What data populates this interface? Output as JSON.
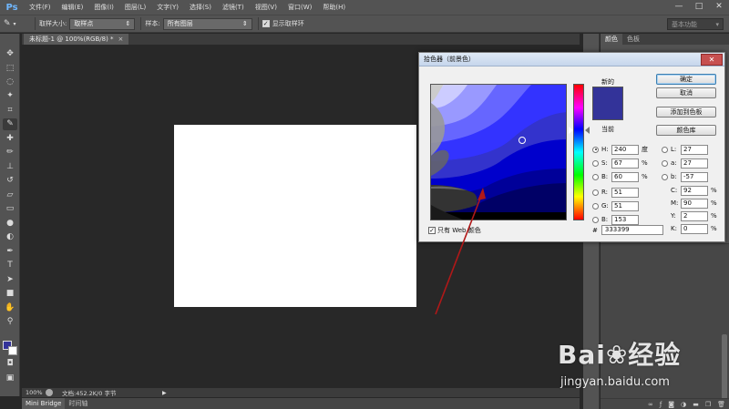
{
  "app": {
    "logo": "Ps",
    "menu": [
      "文件(F)",
      "编辑(E)",
      "图像(I)",
      "图层(L)",
      "文字(Y)",
      "选择(S)",
      "滤镜(T)",
      "视图(V)",
      "窗口(W)",
      "帮助(H)"
    ],
    "window_controls": [
      "—",
      "□",
      "✕"
    ]
  },
  "options_bar": {
    "sample_size_label": "取样大小:",
    "sample_size_value": "取样点",
    "sample_label": "样本:",
    "sample_value": "所有图层",
    "show_ring_label": "显示取样环",
    "show_ring_checked": true,
    "workspace_value": "基本功能"
  },
  "document": {
    "tab_title": "未标题-1 @ 100%(RGB/8) *",
    "tab_close": "×",
    "zoom": "100%",
    "doc_info": "文档:452.2K/0 字节",
    "canvas_color": "#ffffff"
  },
  "bottom_tabs": [
    "Mini Bridge",
    "时间轴"
  ],
  "right_panel": {
    "tabs": [
      "颜色",
      "色板"
    ]
  },
  "color_picker": {
    "title": "拾色器（前景色）",
    "new_label": "新的",
    "current_label": "当前",
    "buttons": {
      "ok": "确定",
      "cancel": "取消",
      "add_to_swatches": "添加到色板",
      "color_libraries": "颜色库"
    },
    "hsb": [
      {
        "label": "H:",
        "value": "240",
        "unit": "度",
        "selected": true
      },
      {
        "label": "S:",
        "value": "67",
        "unit": "%",
        "selected": false
      },
      {
        "label": "B:",
        "value": "60",
        "unit": "%",
        "selected": false
      }
    ],
    "rgb": [
      {
        "label": "R:",
        "value": "51"
      },
      {
        "label": "G:",
        "value": "51"
      },
      {
        "label": "B:",
        "value": "153"
      }
    ],
    "lab": [
      {
        "label": "L:",
        "value": "27"
      },
      {
        "label": "a:",
        "value": "27"
      },
      {
        "label": "b:",
        "value": "-57"
      }
    ],
    "cmyk": [
      {
        "label": "C:",
        "value": "92",
        "unit": "%"
      },
      {
        "label": "M:",
        "value": "90",
        "unit": "%"
      },
      {
        "label": "Y:",
        "value": "2",
        "unit": "%"
      },
      {
        "label": "K:",
        "value": "0",
        "unit": "%"
      }
    ],
    "hex_label": "#",
    "hex_value": "333399",
    "web_only_label": "只有 Web 颜色",
    "web_only_checked": true,
    "new_color": "#333399",
    "close_glyph": "✕"
  },
  "watermark": {
    "logo": "Bai❀经验",
    "url": "jingyan.baidu.com"
  },
  "colors": {
    "accent": "#333399",
    "annotation_arrow": "#b01818"
  }
}
